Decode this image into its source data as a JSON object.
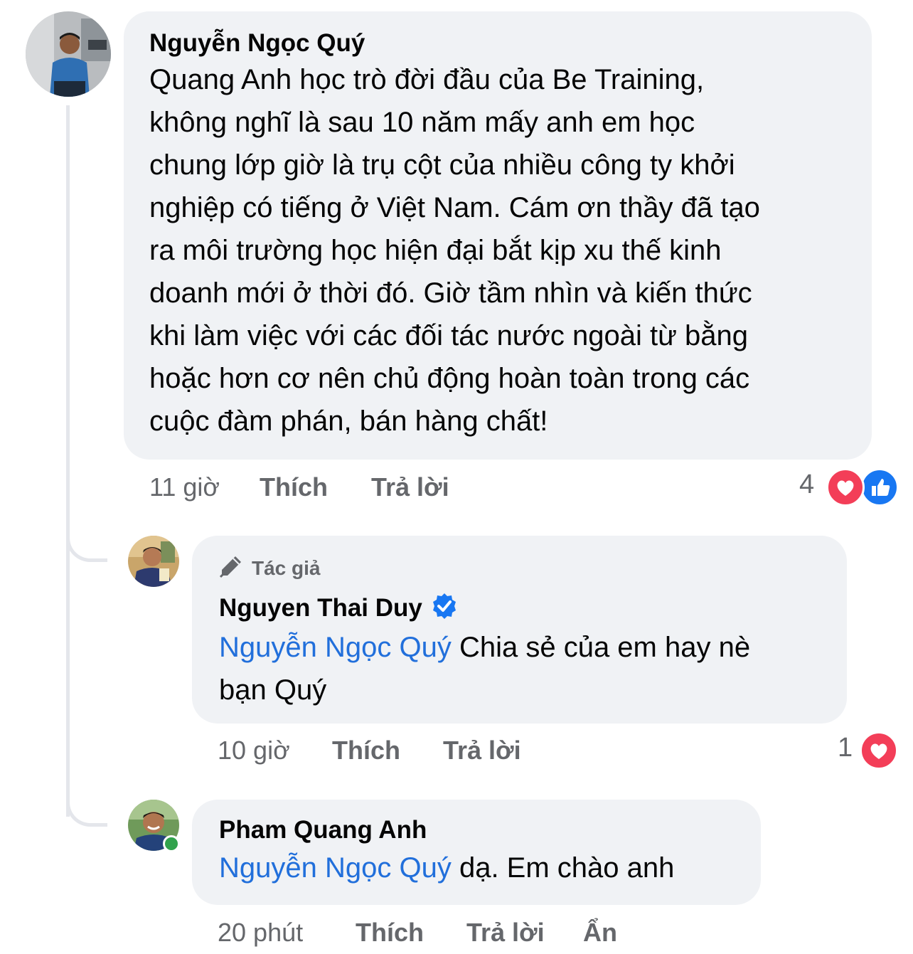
{
  "comments": {
    "c1": {
      "author": "Nguyễn Ngọc Quý",
      "lines": [
        "Quang Anh học trò đời đầu của Be Training,",
        "không nghĩ là sau 10 năm mấy anh em học",
        "chung lớp giờ là trụ cột của nhiều công ty khởi",
        "nghiệp có tiếng ở Việt Nam. Cám ơn thầy đã tạo",
        "ra môi trường học hiện đại bắt kịp xu thế kinh",
        "doanh mới ở thời đó. Giờ tầm nhìn và kiến thức",
        "khi làm việc với các đối tác nước ngoài từ bằng",
        "hoặc hơn cơ nên chủ động hoàn toàn trong các",
        "cuộc đàm phán, bán hàng chất!"
      ],
      "time": "11 giờ",
      "like_label": "Thích",
      "reply_label": "Trả lời",
      "reaction_count": "4",
      "reactions": [
        "love-icon",
        "like-icon"
      ]
    },
    "c2": {
      "badge": "Tác giả",
      "author": "Nguyen Thai Duy",
      "verified": true,
      "mention": "Nguyễn Ngọc Quý",
      "text_line1": " Chia sẻ của em hay nè",
      "text_line2": "bạn Quý",
      "time": "10 giờ",
      "like_label": "Thích",
      "reply_label": "Trả lời",
      "reaction_count": "1",
      "reactions": [
        "love-icon"
      ]
    },
    "c3": {
      "author": "Pham Quang Anh",
      "online": true,
      "mention": "Nguyễn Ngọc Quý",
      "text": " dạ. Em chào anh",
      "time": "20 phút",
      "like_label": "Thích",
      "reply_label": "Trả lời",
      "hide_label": "Ẩn"
    }
  },
  "colors": {
    "bubble": "#f0f2f5",
    "mention": "#216fdb",
    "meta": "#65676b",
    "love": "#f33e58",
    "like": "#1877f2",
    "verified": "#1877f2",
    "online": "#31a24c"
  }
}
